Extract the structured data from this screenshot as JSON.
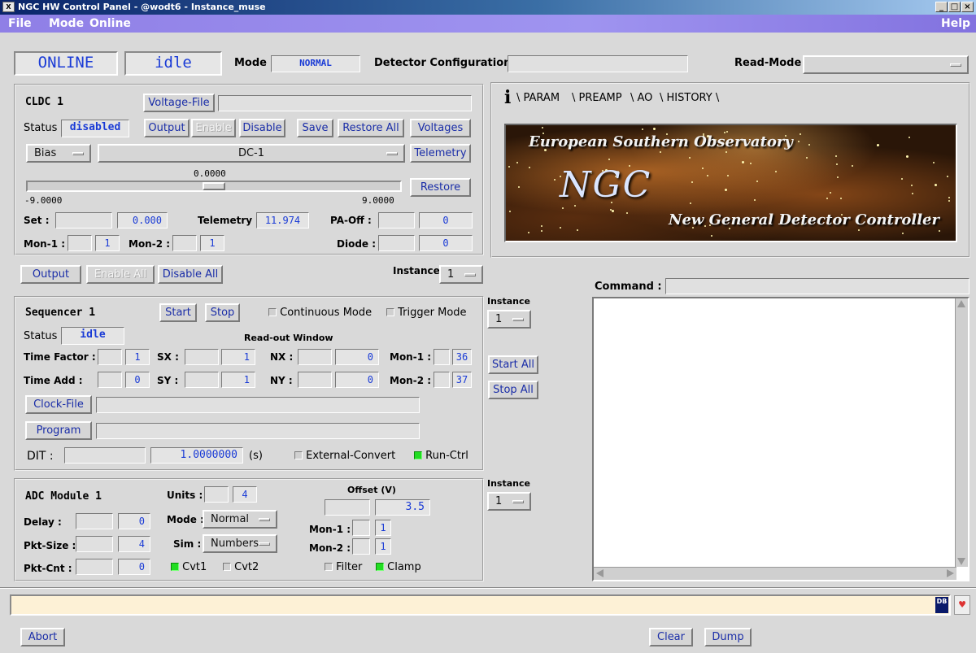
{
  "window": {
    "title": "NGC HW Control Panel - @wodt6 - Instance_muse",
    "controls": [
      "_",
      "□",
      "×"
    ]
  },
  "menu": {
    "file": "File",
    "mode": "Mode",
    "online": "Online",
    "help": "Help"
  },
  "header": {
    "state": "ONLINE",
    "status": "idle",
    "mode_label": "Mode",
    "mode_value": "NORMAL",
    "detector_config_label": "Detector Configuration",
    "detector_config_value": "",
    "read_mode_label": "Read-Mode",
    "read_mode_value": ""
  },
  "cldc": {
    "title": "CLDC 1",
    "voltage_file_button": "Voltage-File",
    "voltage_file_value": "",
    "status_label": "Status",
    "status_value": "disabled",
    "output_button": "Output",
    "enable_button": "Enable",
    "disable_button": "Disable",
    "save_button": "Save",
    "restore_all_button": "Restore All",
    "voltages_button": "Voltages",
    "bias_select": "Bias",
    "channel_select": "DC-1",
    "telemetry_button": "Telemetry",
    "slider_value": "0.0000",
    "slider_min": "-9.0000",
    "slider_max": "9.0000",
    "slider_fraction": 0.5,
    "restore_button": "Restore",
    "set_label": "Set :",
    "set_value": "0.000",
    "telemetry_label": "Telemetry :",
    "telemetry_value": "11.974",
    "paoff_label": "PA-Off :",
    "paoff_value": "0",
    "mon1_label": "Mon-1 :",
    "mon1_value": "1",
    "mon2_label": "Mon-2 :",
    "mon2_value": "1",
    "diode_label": "Diode :",
    "diode_value": "0"
  },
  "cldc_controls": {
    "output_button": "Output",
    "enable_all_button": "Enable All",
    "disable_all_button": "Disable All",
    "instance_label": "Instance",
    "instance_value": "1"
  },
  "tabs": {
    "info_icon": "i",
    "items": [
      "PARAM",
      "PREAMP",
      "AO",
      "HISTORY"
    ]
  },
  "logo": {
    "top_text": "European Southern Observatory",
    "ngc_text": "NGC",
    "bottom_text": "New General Detector Controller"
  },
  "sequencer": {
    "title": "Sequencer 1",
    "start_button": "Start",
    "stop_button": "Stop",
    "continuous_mode": "Continuous Mode",
    "trigger_mode": "Trigger Mode",
    "status_label": "Status",
    "status_value": "idle",
    "readout_window_label": "Read-out Window",
    "time_factor_label": "Time Factor :",
    "time_factor_value": "1",
    "time_add_label": "Time Add :",
    "time_add_value": "0",
    "sx_label": "SX :",
    "sx_value": "1",
    "sy_label": "SY :",
    "sy_value": "1",
    "nx_label": "NX :",
    "nx_value": "0",
    "ny_label": "NY :",
    "ny_value": "0",
    "mon1_label": "Mon-1 :",
    "mon1_value": "36",
    "mon2_label": "Mon-2 :",
    "mon2_value": "37",
    "clock_file_button": "Clock-File",
    "program_button": "Program",
    "dit_label": "DIT :",
    "dit_value": "1.0000000",
    "dit_unit": "(s)",
    "external_convert": "External-Convert",
    "run_ctrl": "Run-Ctrl"
  },
  "seq_side": {
    "instance_label": "Instance",
    "instance_value": "1",
    "start_all_button": "Start All",
    "stop_all_button": "Stop All"
  },
  "adc": {
    "title": "ADC Module 1",
    "units_label": "Units :",
    "units_value": "4",
    "offset_label": "Offset (V)",
    "offset_value": "3.5",
    "delay_label": "Delay :",
    "delay_value": "0",
    "mode_label": "Mode :",
    "mode_value": "Normal",
    "pkt_size_label": "Pkt-Size :",
    "pkt_size_value": "4",
    "sim_label": "Sim :",
    "sim_value": "Numbers",
    "pkt_cnt_label": "Pkt-Cnt :",
    "pkt_cnt_value": "0",
    "cvt1": "Cvt1",
    "cvt2": "Cvt2",
    "mon1_label": "Mon-1 :",
    "mon1_value": "1",
    "mon2_label": "Mon-2 :",
    "mon2_value": "1",
    "filter": "Filter",
    "clamp": "Clamp"
  },
  "adc_side": {
    "instance_label": "Instance",
    "instance_value": "1"
  },
  "command": {
    "label": "Command :",
    "value": ""
  },
  "status_icons": {
    "db_icon": "DB",
    "heart_icon": "♥"
  },
  "footer": {
    "abort_button": "Abort",
    "clear_button": "Clear",
    "dump_button": "Dump"
  },
  "colors": {
    "accent_text": "#1a3bd6",
    "menubar": "#9388ee",
    "titlebar": "#0a246a",
    "led_on": "#22dd22"
  }
}
